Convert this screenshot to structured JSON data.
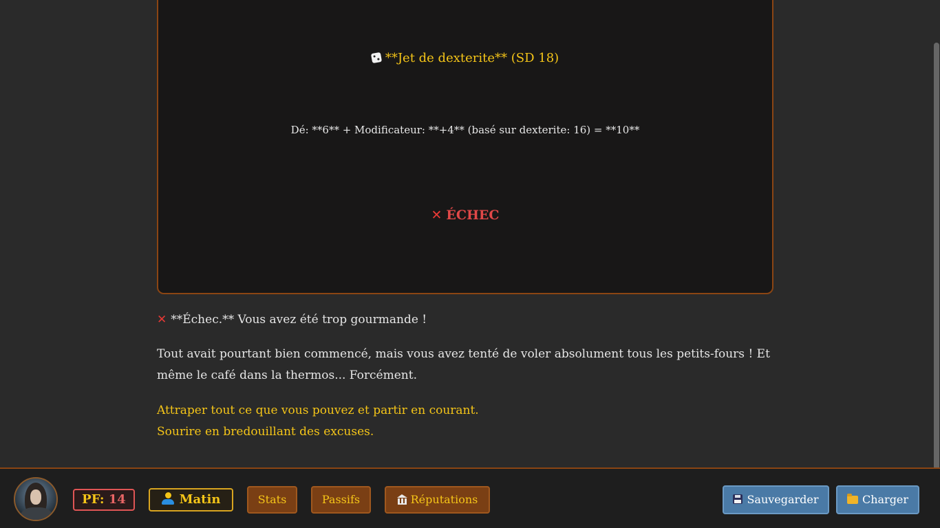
{
  "roll_panel": {
    "title": "**Jet de dexterite** (SD 18)",
    "detail": "Dé: **6** + Modificateur: **+4** (basé sur dexterite: 16) = **10**",
    "result": "ÉCHEC",
    "icons": {
      "dice": "dice-icon",
      "result": "cross-mark-icon"
    },
    "colors": {
      "title": "#f5c518",
      "result": "#e04848",
      "border": "#8b4513"
    }
  },
  "story": {
    "fail_line": "**Échec.** Vous avez été trop gourmande !",
    "narration": "Tout avait pourtant bien commencé, mais vous avez tenté de voler absolument tous les petits-fours ! Et même le café dans la thermos... Forcément.",
    "choices": [
      "Attraper tout ce que vous pouvez et partir en courant.",
      "Sourire en bredouillant des excuses."
    ]
  },
  "status_bar": {
    "pf_label": "PF:",
    "pf_value": "14",
    "time_of_day": "Matin",
    "buttons": {
      "stats": "Stats",
      "passifs": "Passifs",
      "reputations": "Réputations",
      "save": "Sauvegarder",
      "load": "Charger"
    },
    "colors": {
      "accent": "#f5c518",
      "nav_button_bg": "#7a3f14",
      "action_button_bg": "#4a7aa6",
      "pf_border": "#e05555"
    }
  }
}
